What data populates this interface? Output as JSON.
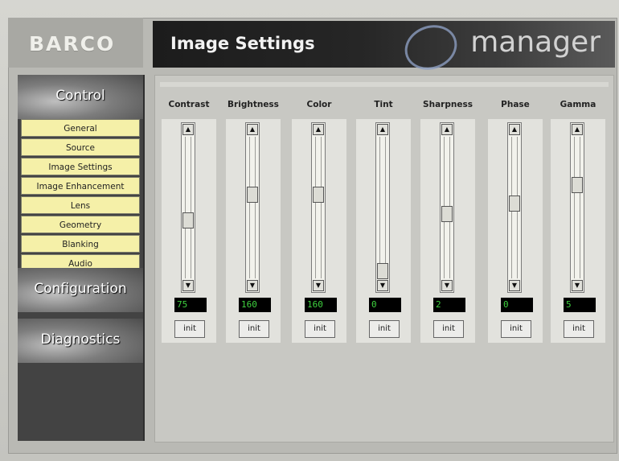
{
  "brand": {
    "logo": "BARCO",
    "emanager": "manager"
  },
  "header": {
    "title": "Image Settings"
  },
  "sidebar": {
    "categories": [
      {
        "label": "Control"
      },
      {
        "label": "Configuration"
      },
      {
        "label": "Diagnostics"
      }
    ],
    "items": [
      {
        "label": "General"
      },
      {
        "label": "Source"
      },
      {
        "label": "Image Settings"
      },
      {
        "label": "Image Enhancement"
      },
      {
        "label": "Lens"
      },
      {
        "label": "Geometry"
      },
      {
        "label": "Blanking"
      },
      {
        "label": "Audio"
      }
    ]
  },
  "controls": [
    {
      "label": "Contrast",
      "value": "75",
      "level": 0.6,
      "init_label": "init"
    },
    {
      "label": "Brightness",
      "value": "160",
      "level": 0.4,
      "init_label": "init"
    },
    {
      "label": "Color",
      "value": "160",
      "level": 0.4,
      "init_label": "init"
    },
    {
      "label": "Tint",
      "value": "0",
      "level": 1.0,
      "init_label": "init"
    },
    {
      "label": "Sharpness",
      "value": "2",
      "level": 0.55,
      "init_label": "init"
    },
    {
      "label": "Phase",
      "value": "0",
      "level": 0.47,
      "init_label": "init"
    },
    {
      "label": "Gamma",
      "value": "5",
      "level": 0.32,
      "init_label": "init"
    }
  ],
  "colors": {
    "menu_bg": "#f5f0a8",
    "value_text": "#3fd23f",
    "banner": "#1c1c1c"
  }
}
